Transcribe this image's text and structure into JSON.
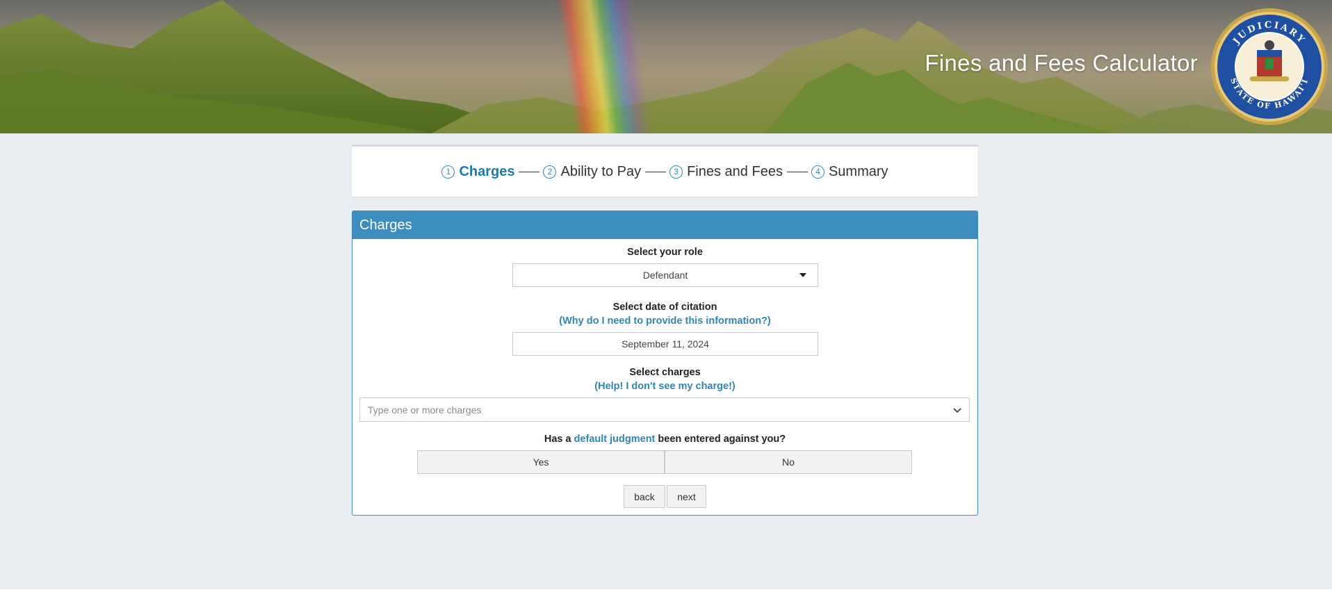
{
  "header": {
    "title": "Fines and Fees Calculator",
    "seal_icon": "hawaii-judiciary-seal-icon",
    "seal_text_top": "JUDICIARY",
    "seal_text_bottom": "STATE OF HAWAI'I"
  },
  "stepper": {
    "steps": [
      {
        "number": "1",
        "label": "Charges",
        "active": true
      },
      {
        "number": "2",
        "label": "Ability to Pay",
        "active": false
      },
      {
        "number": "3",
        "label": "Fines and Fees",
        "active": false
      },
      {
        "number": "4",
        "label": "Summary",
        "active": false
      }
    ]
  },
  "panel": {
    "title": "Charges",
    "role": {
      "label": "Select your role",
      "value": "Defendant"
    },
    "citation_date": {
      "label": "Select date of citation",
      "help_link": "(Why do I need to provide this information?)",
      "value": "September 11, 2024"
    },
    "charges": {
      "label": "Select charges",
      "help_link": "(Help! I don't see my charge!)",
      "placeholder": "Type one or more charges"
    },
    "default_judgment": {
      "question_prefix": "Has a",
      "question_link": "default judgment",
      "question_suffix": "been entered against you?",
      "yes_label": "Yes",
      "no_label": "No"
    },
    "buttons": {
      "back_label": "back",
      "next_label": "next"
    }
  },
  "colors": {
    "page_background": "#e9edf2",
    "panel_header": "#3d8dbe",
    "link": "#2f86b8",
    "active_step": "#1c7aa9"
  }
}
